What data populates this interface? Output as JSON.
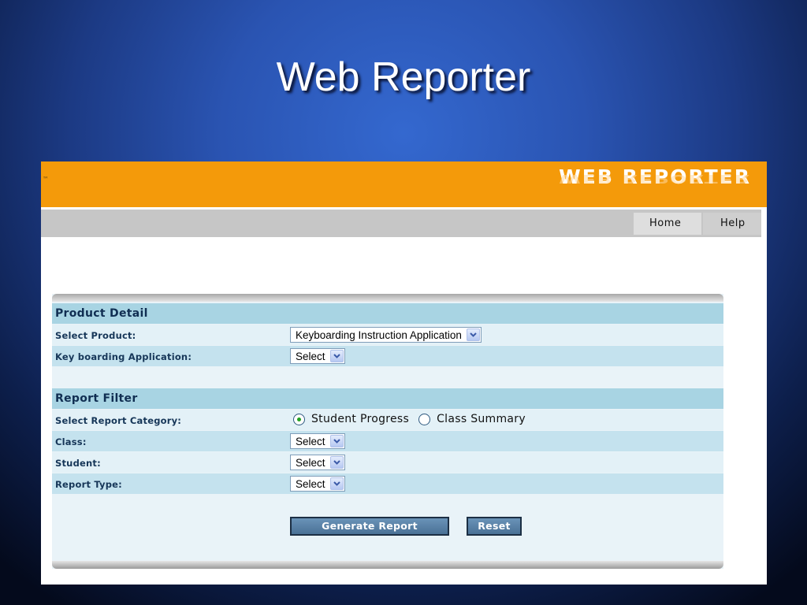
{
  "slide": {
    "title": "Web Reporter"
  },
  "app": {
    "tm": "™",
    "logo_text": "WEB REPORTER",
    "header_color": "#f49a0a"
  },
  "nav": {
    "home": "Home",
    "help": "Help"
  },
  "product_detail": {
    "heading": "Product Detail",
    "select_product_label": "Select Product:",
    "select_product_value": "Keyboarding Instruction Application",
    "keyboarding_app_label": "Key boarding Application:",
    "keyboarding_app_value": "Select"
  },
  "report_filter": {
    "heading": "Report Filter",
    "category_label": "Select Report Category:",
    "category_options": [
      "Student Progress",
      "Class Summary"
    ],
    "category_selected": "Student Progress",
    "class_label": "Class:",
    "class_value": "Select",
    "student_label": "Student:",
    "student_value": "Select",
    "report_type_label": "Report Type:",
    "report_type_value": "Select"
  },
  "actions": {
    "generate": "Generate Report",
    "reset": "Reset"
  }
}
